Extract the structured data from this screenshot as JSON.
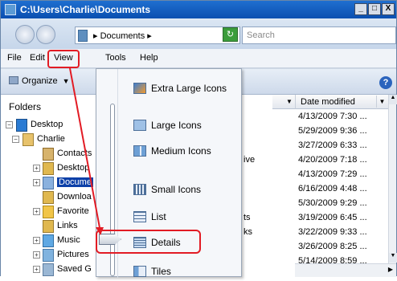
{
  "window": {
    "title": "C:\\Users\\Charlie\\Documents",
    "min_label": "_",
    "max_label": "□",
    "close_label": "X"
  },
  "address": {
    "path": "Documents",
    "path_arrow_prefix": "▸",
    "search_placeholder": "Search"
  },
  "menubar": {
    "file": "File",
    "edit": "Edit",
    "view": "View",
    "tools": "Tools",
    "help": "Help"
  },
  "toolbar": {
    "organize": "Organize"
  },
  "folders": {
    "title": "Folders",
    "items": [
      {
        "label": "Desktop",
        "icon": "desktop-icon"
      },
      {
        "label": "Charlie",
        "icon": "user-folder-icon"
      },
      {
        "label": "Contacts",
        "icon": "contacts-icon"
      },
      {
        "label": "Desktop",
        "icon": "folder-icon"
      },
      {
        "label": "Docume",
        "icon": "documents-icon"
      },
      {
        "label": "Downloa",
        "icon": "folder-icon"
      },
      {
        "label": "Favorite",
        "icon": "favorites-icon"
      },
      {
        "label": "Links",
        "icon": "folder-icon"
      },
      {
        "label": "Music",
        "icon": "music-icon"
      },
      {
        "label": "Pictures",
        "icon": "pictures-icon"
      },
      {
        "label": "Saved G",
        "icon": "saved-games-icon"
      }
    ]
  },
  "columns": {
    "date_modified": "Date modified"
  },
  "files": {
    "dates": [
      "4/13/2009 7:30 ...",
      "5/29/2009 9:36 ...",
      "3/27/2009 6:33 ...",
      "4/20/2009 7:18 ...",
      "4/13/2009 7:29 ...",
      "6/16/2009 4:48 ...",
      "5/30/2009 9:29 ...",
      "3/19/2009 6:45 ...",
      "3/22/2009 9:33 ...",
      "3/26/2009 8:25 ...",
      "5/14/2009 8:59 ..."
    ],
    "name_fragments": [
      "ive",
      "ts",
      "ks"
    ]
  },
  "view_menu": {
    "items": [
      {
        "label": "Extra Large Icons",
        "icon": "extra-large-icons-icon"
      },
      {
        "label": "Large Icons",
        "icon": "large-icons-icon"
      },
      {
        "label": "Medium Icons",
        "icon": "medium-icons-icon"
      },
      {
        "label": "Small Icons",
        "icon": "small-icons-icon"
      },
      {
        "label": "List",
        "icon": "list-icon"
      },
      {
        "label": "Details",
        "icon": "details-icon"
      },
      {
        "label": "Tiles",
        "icon": "tiles-icon"
      }
    ],
    "selected": "Details"
  },
  "colors": {
    "highlight_red": "#e21b24",
    "selection_blue": "#0c40a8"
  }
}
